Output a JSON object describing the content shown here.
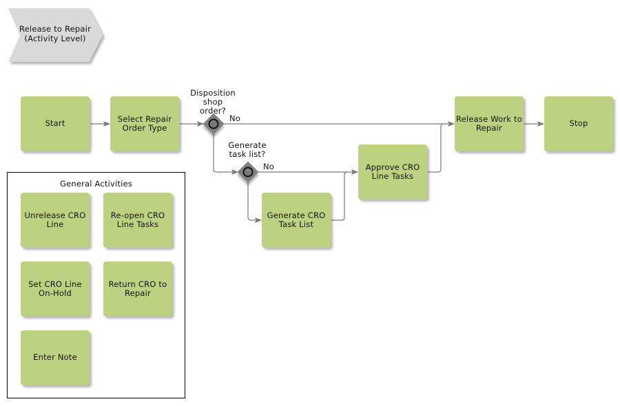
{
  "diagram": {
    "title": "Release to Repair\n(Activity Level)",
    "nodes": {
      "start": "Start",
      "select_repair_order_type": "Select Repair\nOrder Type",
      "release_work": "Release Work to\nRepair",
      "stop": "Stop",
      "approve_cro": "Approve CRO\nLine Tasks",
      "generate_cro": "Generate CRO\nTask List"
    },
    "gateways": {
      "disposition": {
        "question": "Disposition\nshop\norder?",
        "no_label": "No"
      },
      "generate_task": {
        "question": "Generate\ntask list?",
        "no_label": "No"
      }
    },
    "general_activities": {
      "title": "General Activities",
      "items": [
        "Unrelease CRO\nLine",
        "Re-open CRO\nLine Tasks",
        "Set CRO Line\nOn-Hold",
        "Return CRO to\nRepair",
        "Enter Note"
      ]
    },
    "colors": {
      "task_fill": "#bdd280",
      "header_fill": "#d9d9d9",
      "gateway_fill": "#808080",
      "connector": "#7a7a7a"
    }
  }
}
